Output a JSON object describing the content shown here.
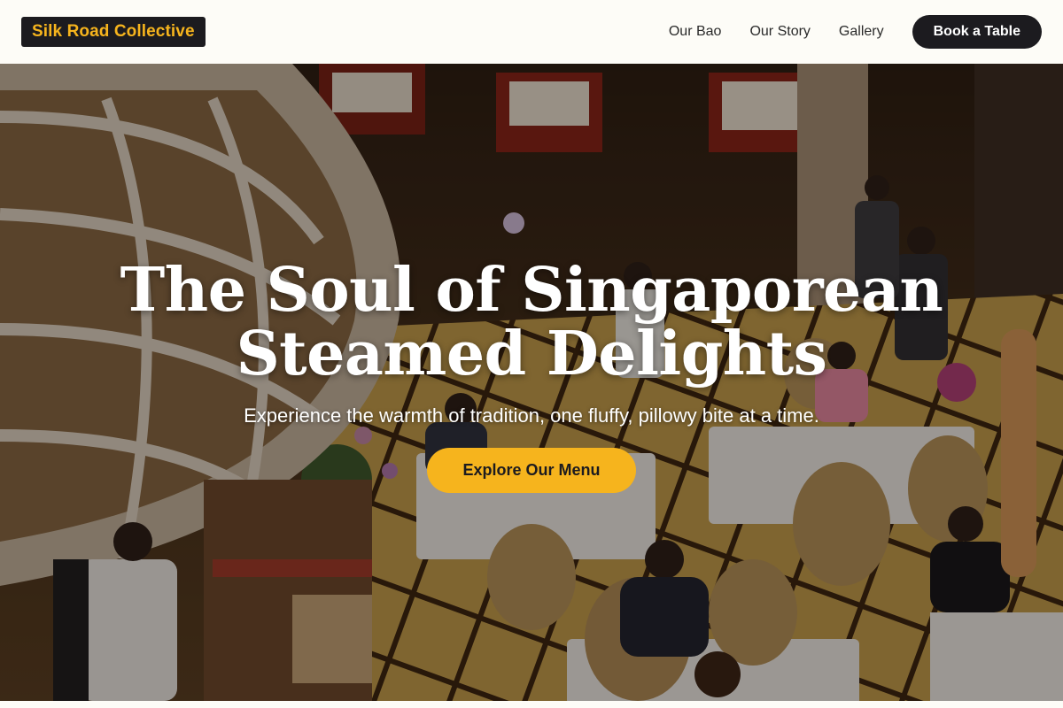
{
  "header": {
    "brand": "Silk Road Collective",
    "nav": [
      {
        "label": "Our Bao"
      },
      {
        "label": "Our Story"
      },
      {
        "label": "Gallery"
      }
    ],
    "cta_label": "Book a Table"
  },
  "hero": {
    "title": "The Soul of Singaporean Steamed Delights",
    "subtitle": "Experience the warmth of tradition, one fluffy, pillowy bite at a time.",
    "cta_label": "Explore Our Menu",
    "background_image": "restaurant-dining-hall-photo"
  },
  "colors": {
    "accent": "#f6b41d",
    "dark": "#1c1b1f",
    "header_bg": "#fdfcf7"
  }
}
